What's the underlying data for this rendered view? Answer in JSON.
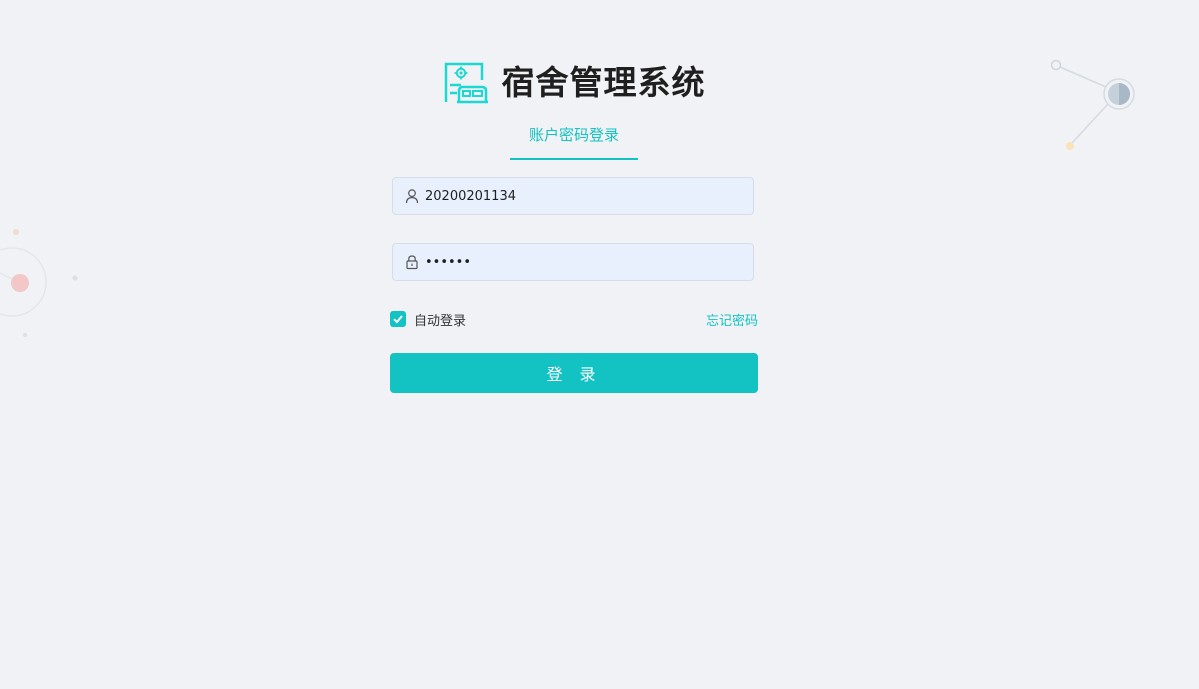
{
  "app": {
    "title": "宿舍管理系统",
    "logo_icon": "dormitory-logo-icon"
  },
  "tabs": [
    {
      "label": "账户密码登录",
      "active": true
    }
  ],
  "form": {
    "username": {
      "value": "20200201134",
      "icon": "user-icon"
    },
    "password": {
      "value": "••••••",
      "icon": "lock-icon"
    },
    "remember": {
      "label": "自动登录",
      "checked": true
    },
    "forgot_label": "忘记密码",
    "submit_label": "登 录"
  },
  "colors": {
    "accent": "#13c2c2",
    "background": "#f0f2f5",
    "input_background": "#e8f0fe",
    "title_text": "#1f1f1f"
  }
}
